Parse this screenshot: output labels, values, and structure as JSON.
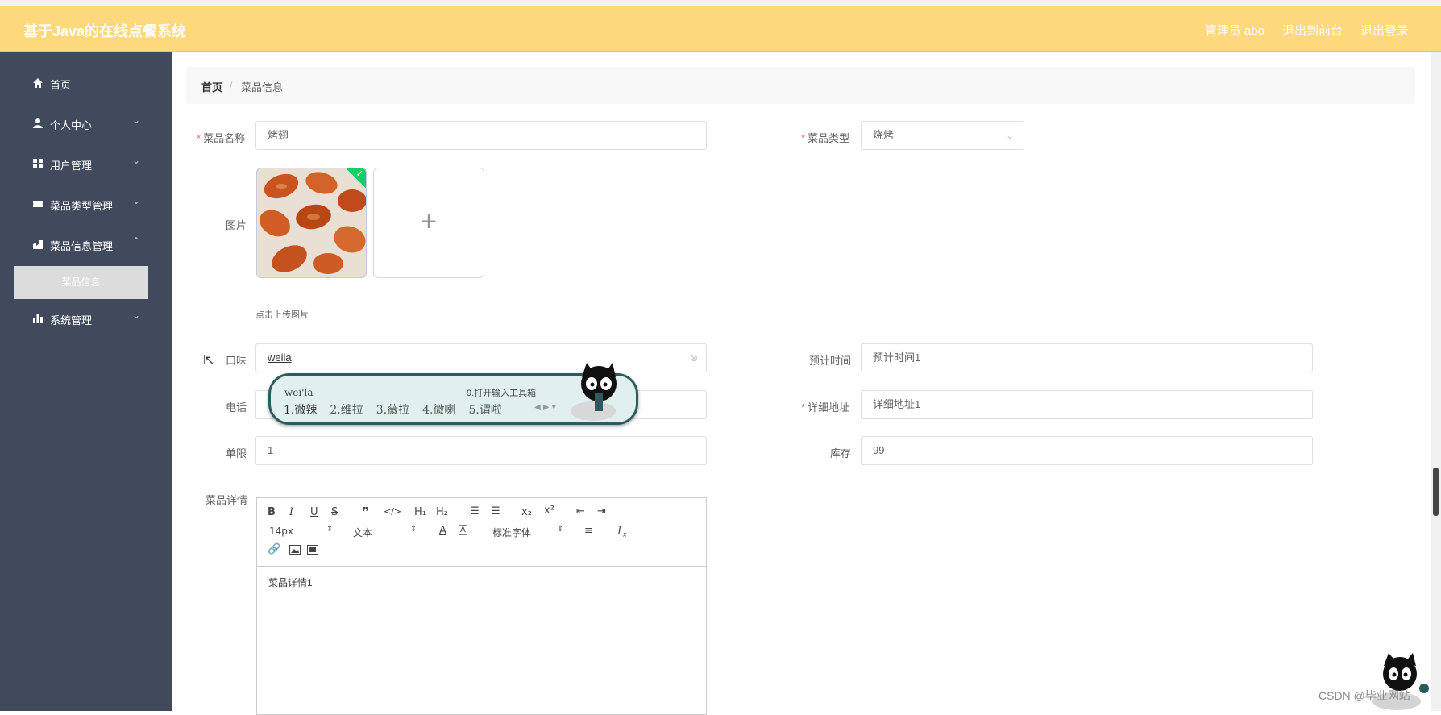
{
  "header": {
    "title": "基于Java的在线点餐系统",
    "admin": "管理员 abo",
    "to_front": "退出到前台",
    "logout": "退出登录"
  },
  "sidebar": {
    "items": [
      {
        "label": "首页",
        "icon": "home-icon"
      },
      {
        "label": "个人中心",
        "icon": "user-icon"
      },
      {
        "label": "用户管理",
        "icon": "grid-icon"
      },
      {
        "label": "菜品类型管理",
        "icon": "ticket-icon"
      },
      {
        "label": "菜品信息管理",
        "icon": "building-icon"
      },
      {
        "label": "系统管理",
        "icon": "bar-chart-icon"
      }
    ],
    "sub_active": "菜品信息"
  },
  "breadcrumb": {
    "home": "首页",
    "separator": "/",
    "current": "菜品信息"
  },
  "form": {
    "name_label": "菜品名称",
    "name_value": "烤翅",
    "type_label": "菜品类型",
    "type_value": "烧烤",
    "image_label": "图片",
    "upload_hint": "点击上传图片",
    "taste_label": "口味",
    "taste_value": "weila",
    "eta_label": "预计时间",
    "eta_value": "预计时间1",
    "phone_label": "电话",
    "address_label": "详细地址",
    "address_value": "详细地址1",
    "limit_label": "单限",
    "limit_value": "1",
    "stock_label": "库存",
    "stock_value": "99",
    "detail_label": "菜品详情",
    "detail_value": "菜品详情1"
  },
  "editor_toolbar": {
    "size": "14px",
    "header": "文本",
    "font": "标准字体"
  },
  "ime": {
    "pinyin": "wei'la",
    "tool": "9.打开输入工具箱",
    "candidates": [
      "1.微辣",
      "2.维拉",
      "3.薇拉",
      "4.微喇",
      "5.谓啦"
    ]
  },
  "watermark": "CSDN @毕业网站"
}
